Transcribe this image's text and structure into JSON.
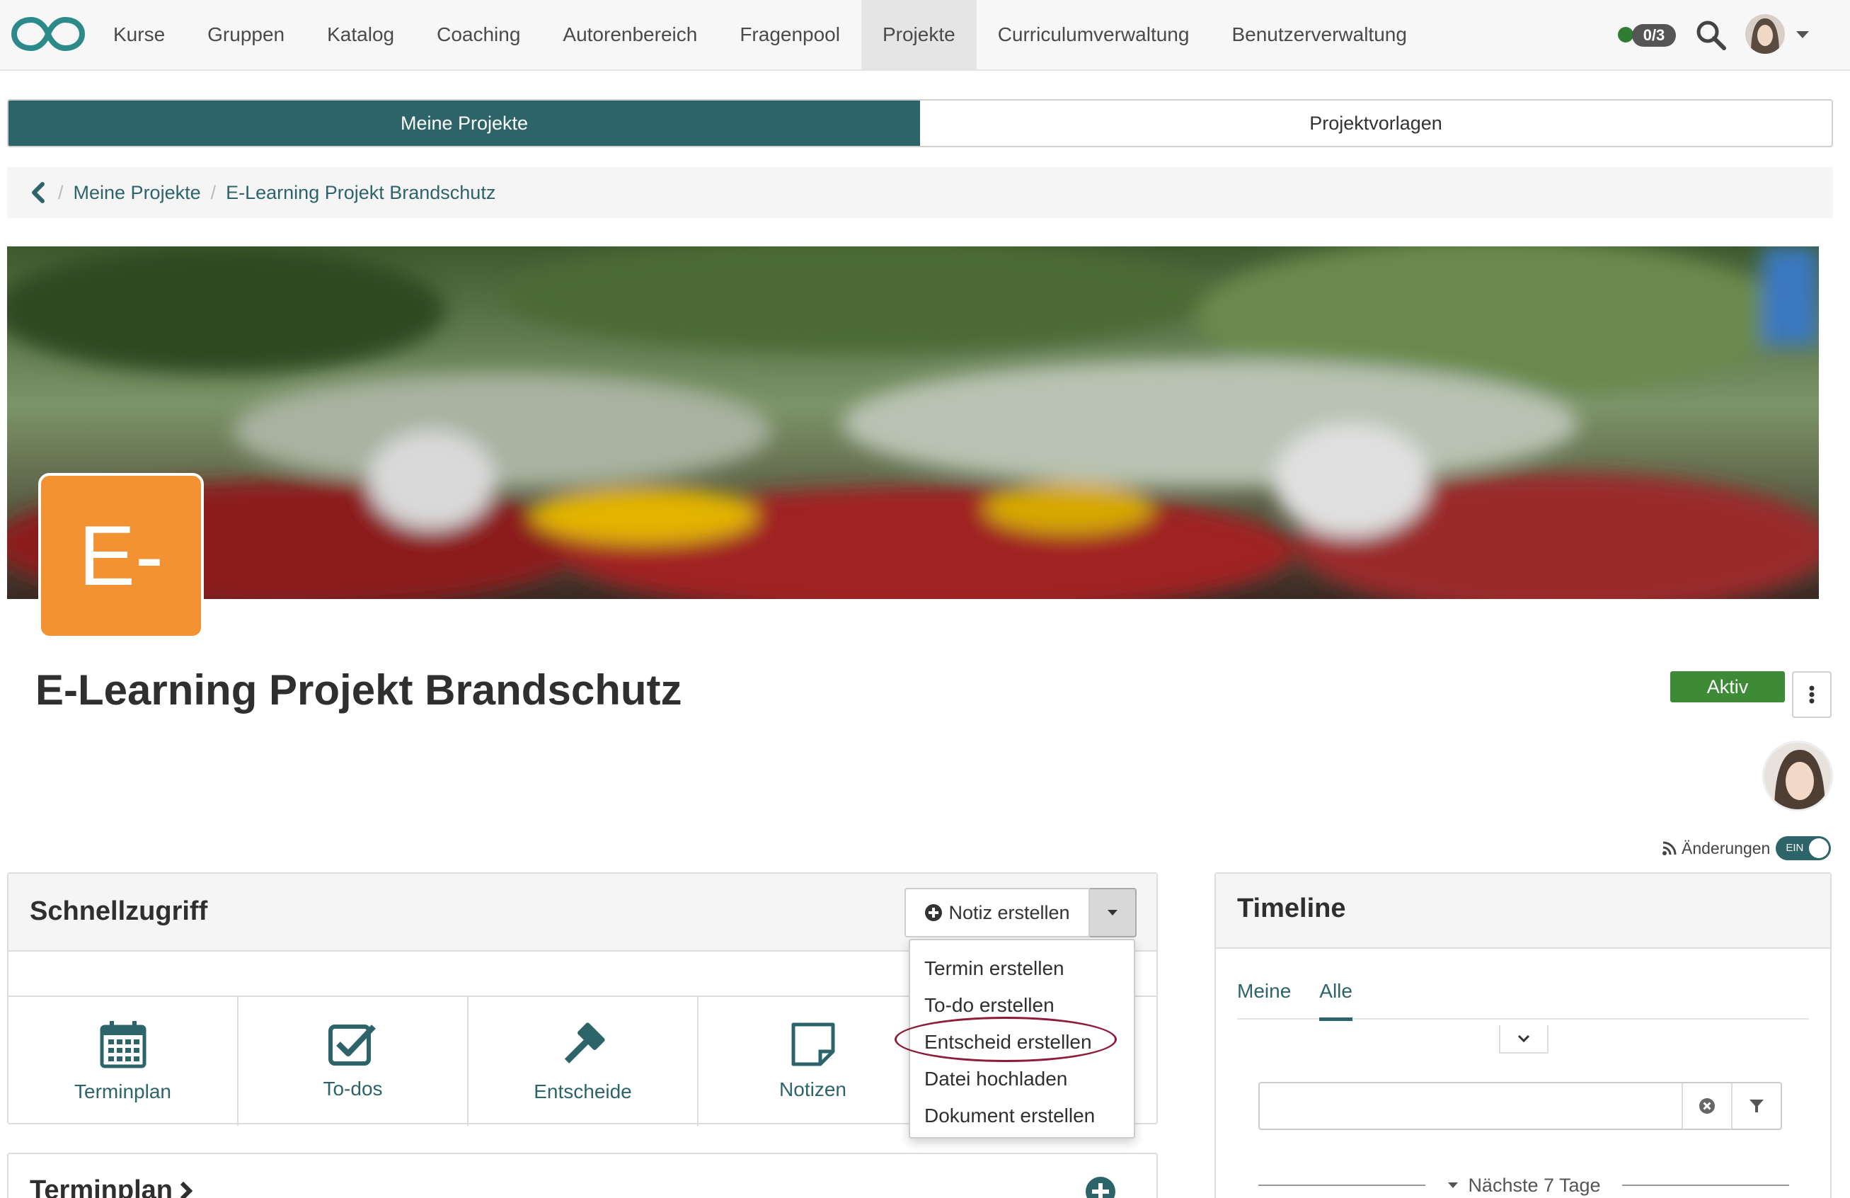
{
  "nav": {
    "items": [
      "Kurse",
      "Gruppen",
      "Katalog",
      "Coaching",
      "Autorenbereich",
      "Fragenpool",
      "Projekte",
      "Curriculumverwaltung",
      "Benutzerverwaltung"
    ],
    "active": "Projekte",
    "counter": "0/3",
    "online_color": "#2e7d32"
  },
  "tabs": {
    "my_projects": "Meine Projekte",
    "templates": "Projektvorlagen"
  },
  "breadcrumb": {
    "level1": "Meine Projekte",
    "level2": "E-Learning Projekt Brandschutz"
  },
  "project": {
    "initials": "E-",
    "title": "E-Learning Projekt Brandschutz",
    "status": "Aktiv",
    "tile_color": "#f39232"
  },
  "changes": {
    "label": "Änderungen",
    "toggle": "EIN"
  },
  "quick_access": {
    "title": "Schnellzugriff",
    "primary_action": "Notiz erstellen",
    "tiles": [
      "Terminplan",
      "To-dos",
      "Entscheide",
      "Notizen"
    ]
  },
  "dropdown": {
    "items": [
      "Termin erstellen",
      "To-do erstellen",
      "Entscheid erstellen",
      "Datei hochladen",
      "Dokument erstellen"
    ],
    "highlighted": "Entscheid erstellen"
  },
  "schedule": {
    "title": "Terminplan"
  },
  "timeline": {
    "title": "Timeline",
    "tabs": [
      "Meine",
      "Alle"
    ],
    "active_tab": "Alle",
    "search_placeholder": "",
    "section": "Nächste 7 Tage"
  },
  "colors": {
    "accent": "#2d6469",
    "status_active": "#3d8b37",
    "highlight": "#8e1b3a"
  }
}
